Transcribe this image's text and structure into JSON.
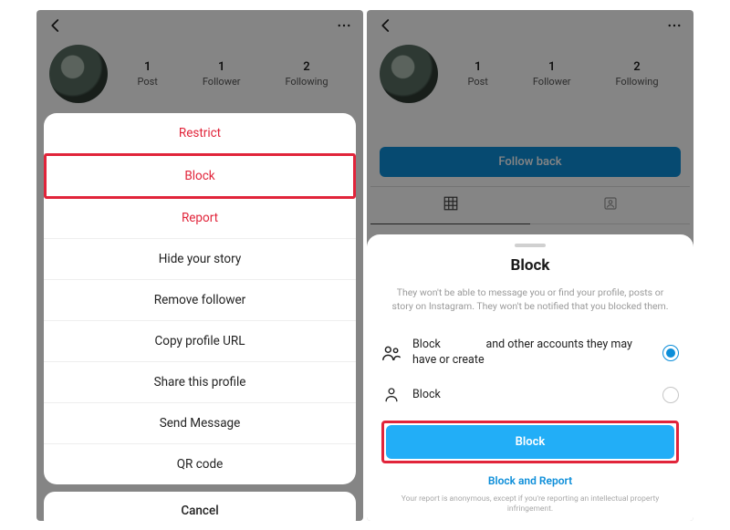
{
  "left": {
    "stats": [
      {
        "num": "1",
        "label": "Post"
      },
      {
        "num": "1",
        "label": "Follower"
      },
      {
        "num": "2",
        "label": "Following"
      }
    ],
    "sheet": {
      "restrict": "Restrict",
      "block": "Block",
      "report": "Report",
      "hide_story": "Hide your story",
      "remove_follower": "Remove follower",
      "copy_url": "Copy profile URL",
      "share_profile": "Share this profile",
      "send_message": "Send Message",
      "qr_code": "QR code",
      "cancel": "Cancel"
    }
  },
  "right": {
    "stats": [
      {
        "num": "1",
        "label": "Post"
      },
      {
        "num": "1",
        "label": "Follower"
      },
      {
        "num": "2",
        "label": "Following"
      }
    ],
    "follow_back": "Follow back",
    "sheet": {
      "title": "Block",
      "desc": "They won't be able to message you or find your profile, posts or story on Instagram. They won't be notified that you blocked them.",
      "option_multi_a": "Block",
      "option_multi_b": "and other accounts they may have or create",
      "option_single": "Block",
      "block_btn": "Block",
      "block_report": "Block and Report",
      "legal": "Your report is anonymous, except if you're reporting an intellectual property infringement."
    }
  }
}
